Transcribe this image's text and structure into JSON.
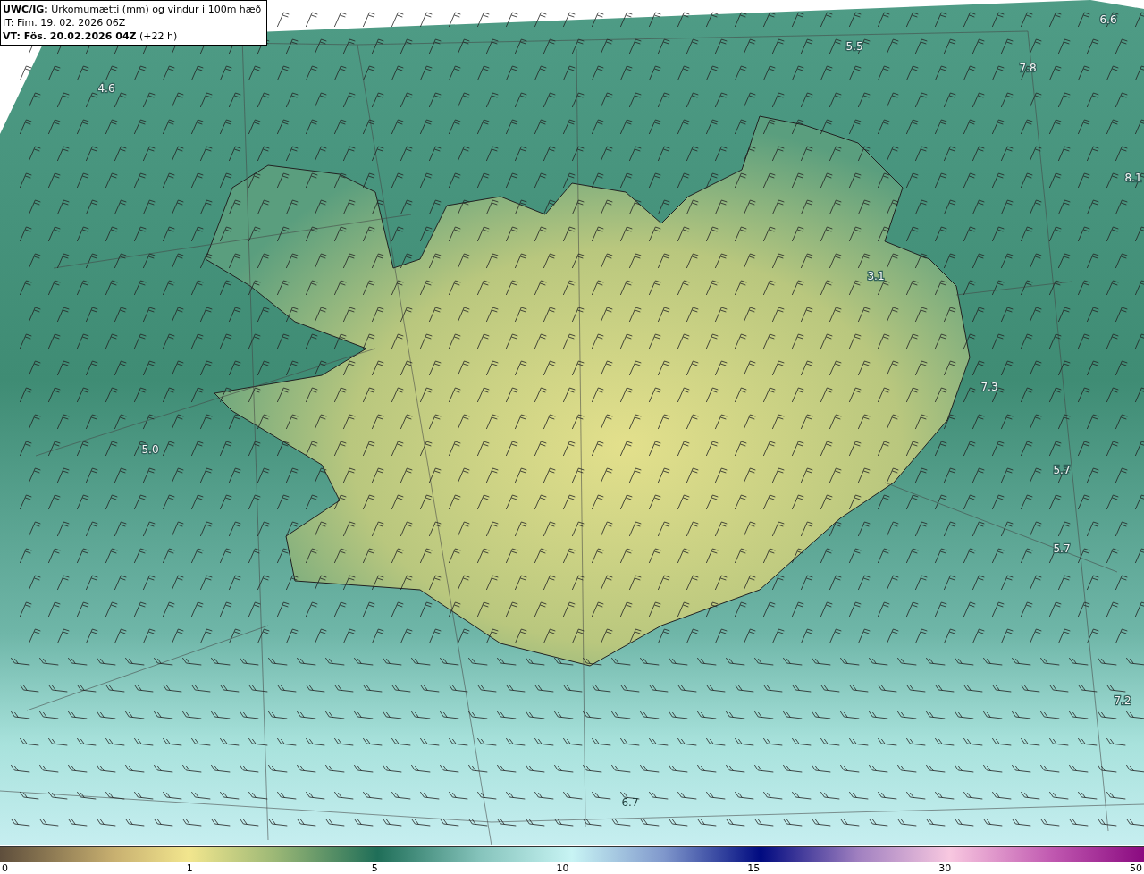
{
  "header": {
    "lines": [
      "**UWC/IG:** Úrkomumætti (mm) og vindur i 100m hæð",
      "IT: Fim. 19. 02. 2026 06Z",
      "**VT: Fös. 20.02.2026 04Z** (+22 h)"
    ]
  },
  "map_labels": [
    "4.6",
    "5.5",
    "6.6",
    "7.8",
    "8.1",
    "3.1",
    "7.3",
    "5.0",
    "5.7",
    "5.7",
    "7.2",
    "6.7"
  ],
  "colorbar": {
    "ticks": [
      "0",
      "1",
      "5",
      "10",
      "15",
      "30",
      "50"
    ]
  }
}
